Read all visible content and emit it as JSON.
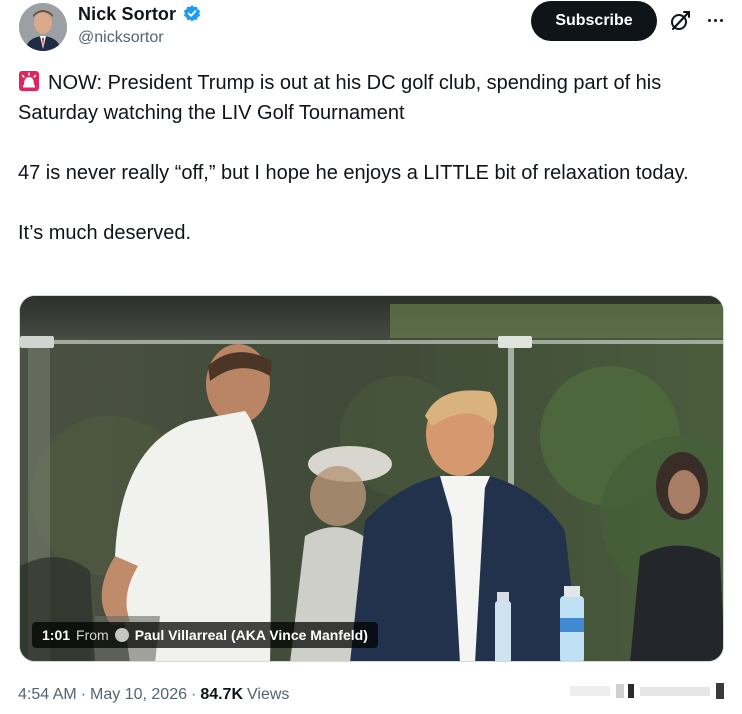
{
  "author": {
    "display_name": "Nick Sortor",
    "handle": "@nicksortor",
    "verified_icon": "verified-badge-icon",
    "avatar_icon": "profile-avatar"
  },
  "actions": {
    "subscribe_label": "Subscribe",
    "grok_icon": "grok-icon",
    "more_icon": "more-options-icon"
  },
  "tweet": {
    "emoji_icon": "rotating-light-siren-icon",
    "paragraphs": [
      "NOW: President Trump is out at his DC golf club, spending part of his Saturday watching the LIV Golf Tournament",
      "47 is never really “off,” but I hope he enjoys a LITTLE bit of relaxation today.",
      "It’s much deserved."
    ]
  },
  "video": {
    "duration": "1:01",
    "from_label": "From",
    "source_name": "Paul Villarreal (AKA Vince Manfeld)"
  },
  "footer": {
    "time": "4:54 AM",
    "date": "May 10, 2026",
    "separator": "·",
    "view_count": "84.7K",
    "views_label": "Views"
  },
  "colors": {
    "text_primary": "#0f1419",
    "text_secondary": "#536471",
    "verified_blue": "#1d9bf0",
    "subscribe_bg": "#0f1419",
    "siren_red": "#e0245e"
  }
}
